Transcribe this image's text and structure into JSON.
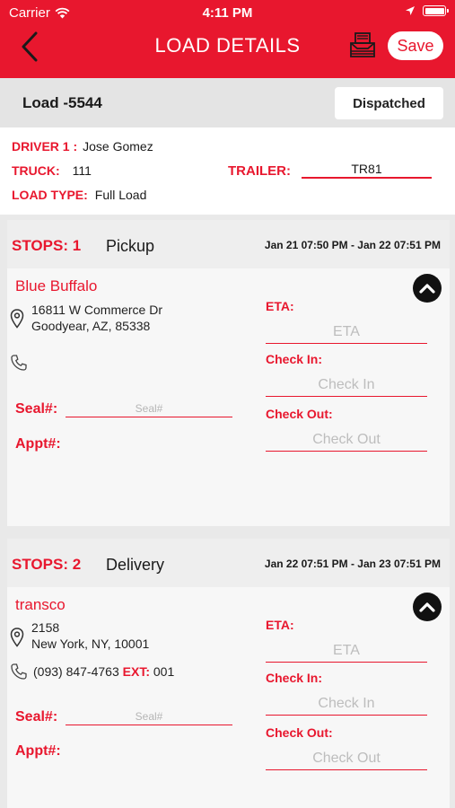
{
  "status_bar": {
    "carrier": "Carrier",
    "time": "4:11 PM"
  },
  "nav": {
    "title": "LOAD DETAILS",
    "save_label": "Save"
  },
  "load": {
    "id": "Load -5544",
    "status": "Dispatched"
  },
  "driver_info": {
    "driver_label": "DRIVER 1 :",
    "driver_value": "Jose Gomez",
    "truck_label": "TRUCK:",
    "truck_value": "111",
    "trailer_label": "TRAILER:",
    "trailer_value": "TR81",
    "load_type_label": "LOAD TYPE:",
    "load_type_value": "Full Load"
  },
  "stops": [
    {
      "number": "STOPS: 1",
      "type": "Pickup",
      "time_range": "Jan 21 07:50 PM - Jan 22 07:51 PM",
      "name": "Blue Buffalo",
      "address_line1": "16811 W Commerce Dr",
      "address_line2": "Goodyear, AZ, 85338",
      "phone": "",
      "ext_label": "",
      "ext_value": "",
      "seal_label": "Seal#:",
      "seal_placeholder": "Seal#",
      "appt_label": "Appt#:",
      "eta_label": "ETA:",
      "eta_placeholder": "ETA",
      "checkin_label": "Check In:",
      "checkin_placeholder": "Check In",
      "checkout_label": "Check Out:",
      "checkout_placeholder": "Check Out"
    },
    {
      "number": "STOPS: 2",
      "type": "Delivery",
      "time_range": "Jan 22 07:51 PM - Jan 23 07:51 PM",
      "name": "transco",
      "address_line1": "2158",
      "address_line2": "New York, NY, 10001",
      "phone": "(093) 847-4763",
      "ext_label": "EXT:",
      "ext_value": "001",
      "seal_label": "Seal#:",
      "seal_placeholder": "Seal#",
      "appt_label": "Appt#:",
      "eta_label": "ETA:",
      "eta_placeholder": "ETA",
      "checkin_label": "Check In:",
      "checkin_placeholder": "Check In",
      "checkout_label": "Check Out:",
      "checkout_placeholder": "Check Out"
    }
  ],
  "colors": {
    "brand_red": "#e8172e",
    "background": "#e9e9e9"
  },
  "icons": [
    "wifi-icon",
    "location-arrow-icon",
    "battery-icon",
    "back-chevron-icon",
    "tray-icon",
    "map-pin-icon",
    "phone-icon",
    "chevron-up-icon"
  ]
}
